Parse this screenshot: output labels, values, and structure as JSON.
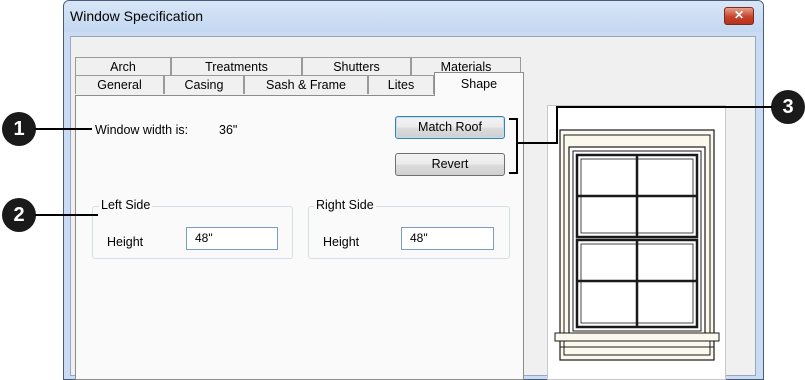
{
  "window": {
    "title": "Window Specification",
    "close_glyph": "✕"
  },
  "tabs": {
    "row1": [
      "Arch",
      "Treatments",
      "Shutters",
      "Materials"
    ],
    "row2": [
      "General",
      "Casing",
      "Sash & Frame",
      "Lites",
      "Shape"
    ],
    "active": "Shape"
  },
  "shape": {
    "width_label": "Window width is:",
    "width_value": "36\"",
    "match_roof_label": "Match Roof",
    "revert_label": "Revert",
    "left_side": {
      "legend": "Left Side",
      "height_label": "Height",
      "height_value": "48\""
    },
    "right_side": {
      "legend": "Right Side",
      "height_label": "Height",
      "height_value": "48\""
    }
  },
  "callouts": [
    "1",
    "2",
    "3"
  ],
  "icons": {
    "close": "close-icon",
    "preview": "window-preview-icon"
  },
  "colors": {
    "title_bar": "#c9dcf3",
    "close_button": "#c7432a",
    "input_border": "#7a9cc5",
    "default_button": "#3c7fb1"
  }
}
